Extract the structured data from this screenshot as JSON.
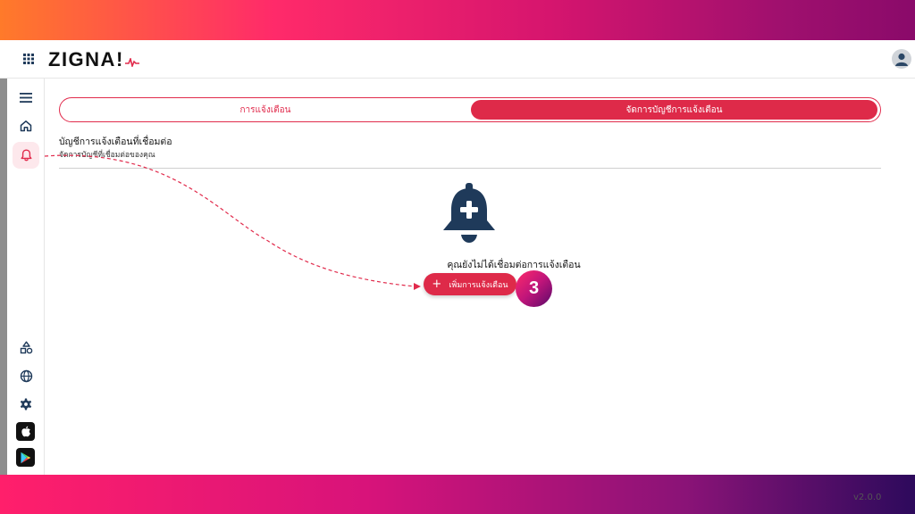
{
  "app": {
    "logo_text": "ZIGNA!",
    "version": "v2.0.0",
    "accent_color": "#de2a49"
  },
  "topbar": {
    "icons": [
      "apps-grid-icon",
      "user-avatar-icon"
    ]
  },
  "sidebar": {
    "top_items": [
      {
        "name": "menu",
        "icon": "hamburger-icon"
      },
      {
        "name": "home",
        "icon": "home-icon"
      },
      {
        "name": "notifications",
        "icon": "bell-icon",
        "active": true
      }
    ],
    "bottom_items": [
      {
        "name": "shapes",
        "icon": "shapes-icon"
      },
      {
        "name": "language",
        "icon": "globe-icon"
      },
      {
        "name": "settings",
        "icon": "gear-icon"
      },
      {
        "name": "app-store",
        "icon": "apple-icon"
      },
      {
        "name": "google-play",
        "icon": "play-store-icon"
      }
    ]
  },
  "tabs": {
    "items": [
      {
        "label": "การแจ้งเตือน",
        "active": false
      },
      {
        "label": "จัดการบัญชีการแจ้งเตือน",
        "active": true
      }
    ]
  },
  "section": {
    "title": "บัญชีการแจ้งเตือนที่เชื่อมต่อ",
    "subtitle": "จัดการบัญชีที่เชื่อมต่อของคุณ"
  },
  "empty_state": {
    "icon": "bell-plus-icon",
    "message": "คุณยังไม่ได้เชื่อมต่อการแจ้งเตือน",
    "add_button_label": "เพิ่มการแจ้งเตือน",
    "add_button_icon": "plus-icon"
  },
  "tutorial": {
    "step_number": "3"
  }
}
